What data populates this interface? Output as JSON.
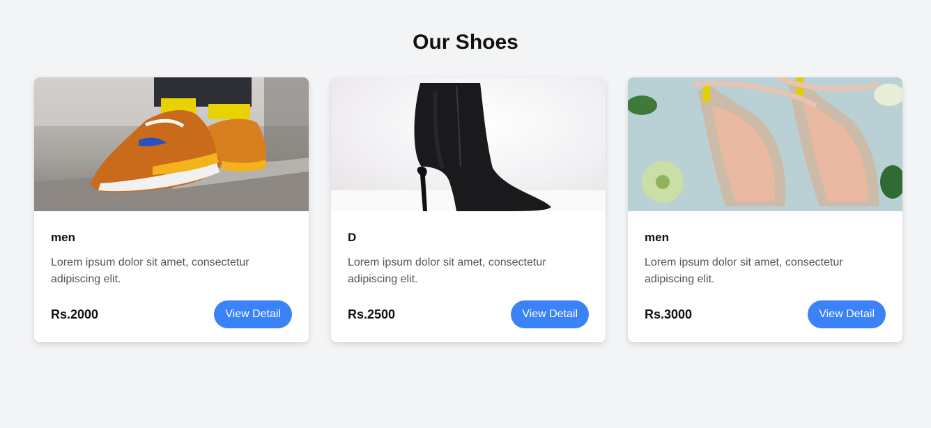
{
  "page": {
    "title": "Our Shoes"
  },
  "products": [
    {
      "title": "men",
      "description": "Lorem ipsum dolor sit amet, consectetur adipiscing elit.",
      "price": "Rs.2000",
      "button": "View Detail",
      "image": "orange-sneakers-photo"
    },
    {
      "title": "D",
      "description": "Lorem ipsum dolor sit amet, consectetur adipiscing elit.",
      "price": "Rs.2500",
      "button": "View Detail",
      "image": "black-ankle-boot-photo"
    },
    {
      "title": "men",
      "description": "Lorem ipsum dolor sit amet, consectetur adipiscing elit.",
      "price": "Rs.3000",
      "button": "View Detail",
      "image": "sparkly-heels-photo"
    }
  ],
  "colors": {
    "accent": "#3b82f6",
    "background": "#f3f4f6"
  }
}
